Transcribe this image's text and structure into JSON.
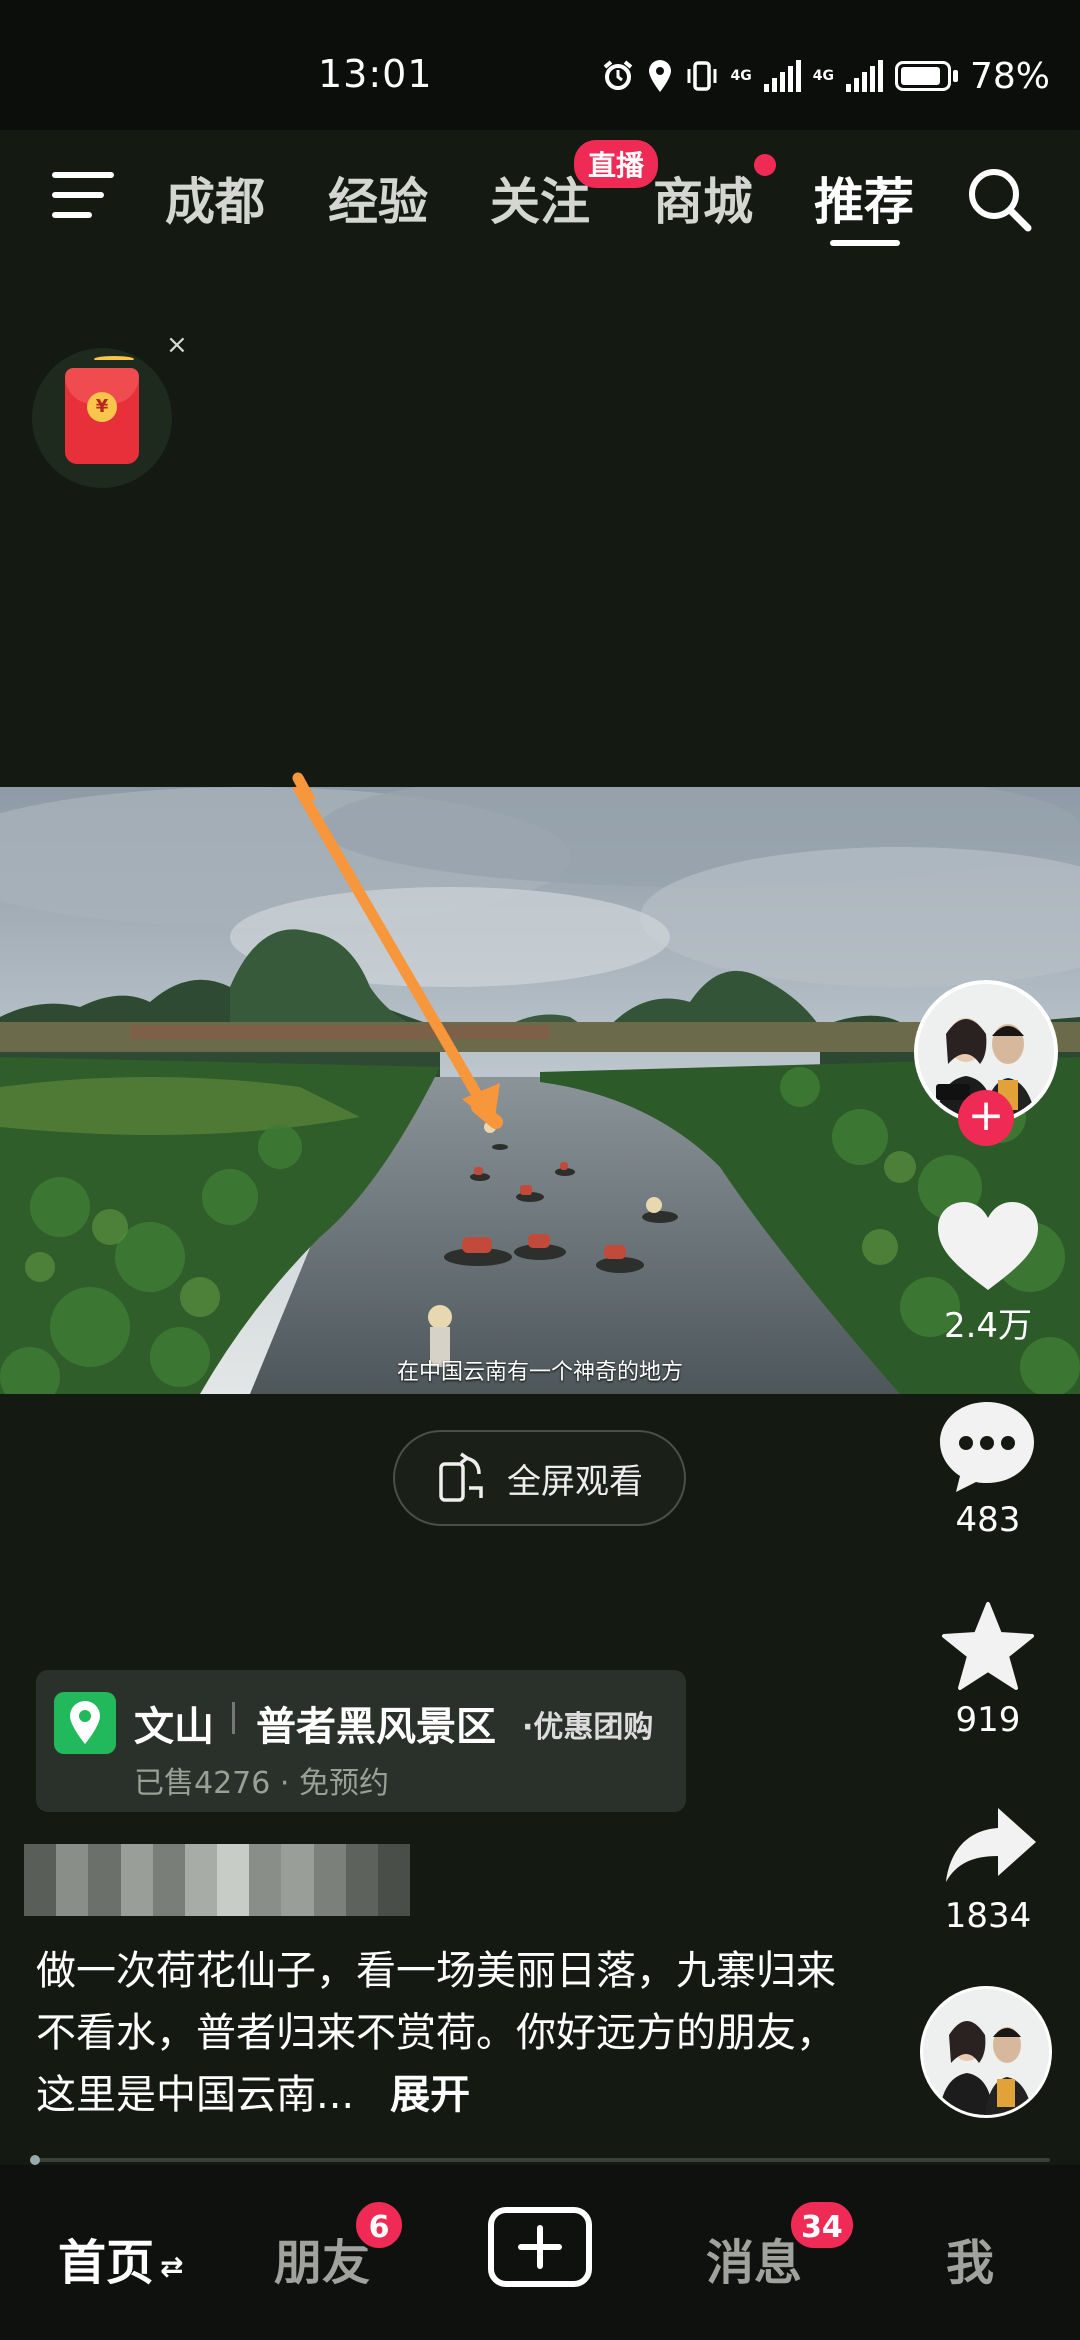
{
  "status_bar": {
    "time": "13:01",
    "battery": "78%",
    "network_1": "4G",
    "network_2": "4G"
  },
  "top_tabs": [
    {
      "label": "成都",
      "active": false
    },
    {
      "label": "经验",
      "active": false
    },
    {
      "label": "关注",
      "active": false,
      "badge": "直播"
    },
    {
      "label": "商城",
      "active": false,
      "dot": true
    },
    {
      "label": "推荐",
      "active": true
    }
  ],
  "icons": {
    "menu": "menu-icon",
    "search": "search-icon",
    "red_packet": "red-packet-icon",
    "close": "close-icon",
    "like": "heart-icon",
    "comment": "comment-icon",
    "favorite": "star-icon",
    "share": "share-icon",
    "location": "location-pin-icon",
    "fullscreen": "rotate-phone-icon",
    "create": "plus-icon"
  },
  "red_packet": {
    "close_glyph": "×",
    "coin_glyph": "¥"
  },
  "video": {
    "subtitle": "在中国云南有一个神奇的地方"
  },
  "fullscreen": {
    "label": "全屏观看"
  },
  "actions": {
    "likes": "2.4万",
    "comments": "483",
    "favorites": "919",
    "shares": "1834",
    "follow_glyph": "+"
  },
  "poi": {
    "city": "文山",
    "name": "普者黑风景区",
    "tag": "·优惠团购",
    "sub": "已售4276 · 免预约"
  },
  "caption": {
    "text": "做一次荷花仙子，看一场美丽日落，九寨归来不看水，普者归来不赏荷。你好远方的朋友，这里是中国云南...",
    "more": "展开"
  },
  "bottom_nav": {
    "home": "首页",
    "home_switch": "⇄",
    "friends": "朋友",
    "friends_badge": "6",
    "messages": "消息",
    "messages_badge": "34",
    "me": "我"
  },
  "colors": {
    "accent": "#ef2b55",
    "background": "#141a12",
    "poi_green": "#21b95b",
    "arrow": "#f7963a"
  }
}
